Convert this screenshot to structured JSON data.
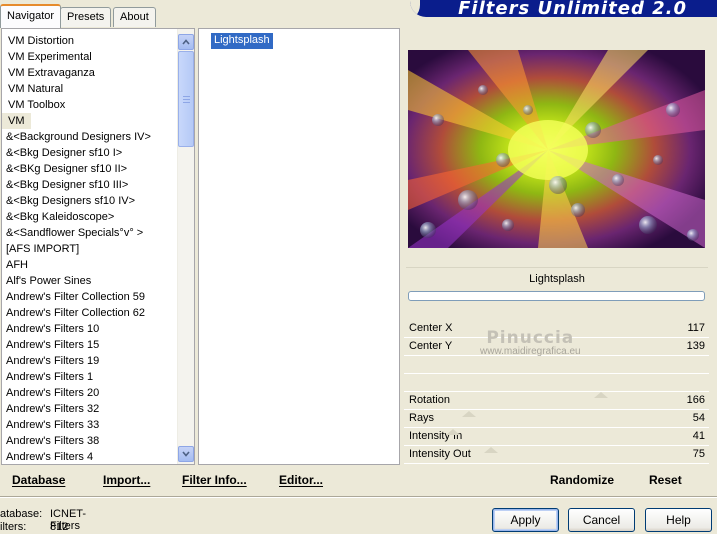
{
  "window": {
    "title": "Filters Unlimited 2.0"
  },
  "tabs": [
    {
      "label": "Navigator",
      "active": true
    },
    {
      "label": "Presets",
      "active": false
    },
    {
      "label": "About",
      "active": false
    }
  ],
  "categories": [
    "VM Distortion",
    "VM Experimental",
    "VM Extravaganza",
    "VM Natural",
    "VM Toolbox",
    "VM",
    "&<Background Designers IV>",
    "&<Bkg Designer sf10 I>",
    "&<BKg Designer sf10 II>",
    "&<Bkg Designer sf10 III>",
    "&<Bkg Designers sf10 IV>",
    "&<Bkg Kaleidoscope>",
    "&<Sandflower Specials°v° >",
    "[AFS IMPORT]",
    "AFH",
    "Alf's Power Sines",
    "Andrew's Filter Collection 59",
    "Andrew's Filter Collection 62",
    "Andrew's Filters 10",
    "Andrew's Filters 15",
    "Andrew's Filters 19",
    "Andrew's Filters 1",
    "Andrew's Filters 20",
    "Andrew's Filters 32",
    "Andrew's Filters 33",
    "Andrew's Filters 38",
    "Andrew's Filters 4"
  ],
  "selected_category": "VM",
  "filters": [
    "Lightsplash"
  ],
  "selected_filter": "Lightsplash",
  "preview": {
    "filter_name": "Lightsplash"
  },
  "params": {
    "center_x": {
      "label": "Center X",
      "value": "117"
    },
    "center_y": {
      "label": "Center Y",
      "value": "139"
    },
    "rotation": {
      "label": "Rotation",
      "value": "166"
    },
    "rays": {
      "label": "Rays",
      "value": "54"
    },
    "intensity_in": {
      "label": "Intensity In",
      "value": "41"
    },
    "intensity_out": {
      "label": "Intensity Out",
      "value": "75"
    }
  },
  "watermark": {
    "name": "Pinuccia",
    "site": "www.maidiregrafica.eu"
  },
  "toolbar": {
    "database": "Database",
    "import": "Import...",
    "filter_info": "Filter Info...",
    "editor": "Editor...",
    "randomize": "Randomize",
    "reset": "Reset"
  },
  "status": {
    "database_label": "atabase:",
    "database_value": "ICNET-Filters",
    "filters_label": "ilters:",
    "filters_value": "812"
  },
  "buttons": {
    "apply": "Apply",
    "cancel": "Cancel",
    "help": "Help"
  },
  "colors": {
    "banner": "#0a1d8c",
    "selection": "#316ac5",
    "tab_highlight": "#e68b2c"
  }
}
